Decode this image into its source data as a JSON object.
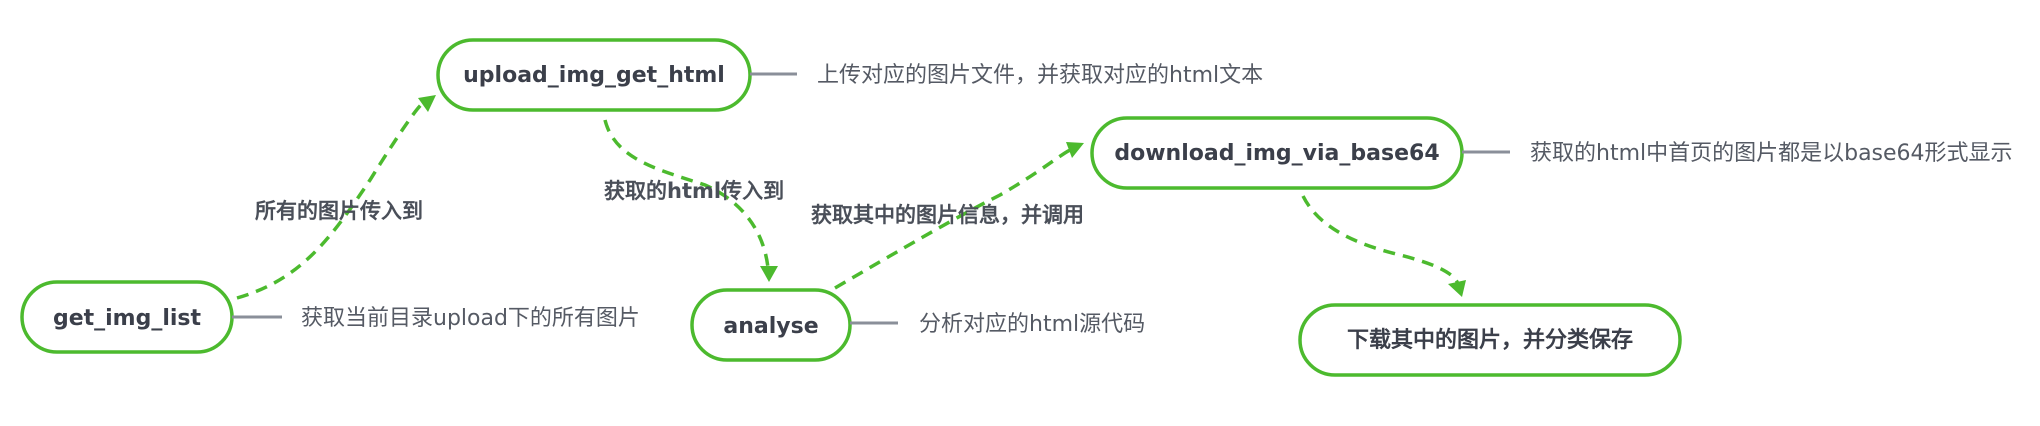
{
  "nodes": {
    "get_img_list": {
      "label": "get_img_list",
      "desc": "获取当前目录upload下的所有图片"
    },
    "upload_img_get_html": {
      "label": "upload_img_get_html",
      "desc": "上传对应的图片文件，并获取对应的html文本"
    },
    "analyse": {
      "label": "analyse",
      "desc": "分析对应的html源代码"
    },
    "download_img_via_base64": {
      "label": "download_img_via_base64",
      "desc": "获取的html中首页的图片都是以base64形式显示"
    },
    "save": {
      "label": "下载其中的图片，并分类保存"
    }
  },
  "edges": {
    "e1": {
      "from": "get_img_list",
      "to": "upload_img_get_html",
      "label": "所有的图片传入到"
    },
    "e2": {
      "from": "upload_img_get_html",
      "to": "analyse",
      "label": "获取的html传入到"
    },
    "e3": {
      "from": "analyse",
      "to": "download_img_via_base64",
      "label": "获取其中的图片信息，并调用"
    },
    "e4": {
      "from": "download_img_via_base64",
      "to": "save",
      "label": ""
    }
  },
  "colors": {
    "node_border": "#4cba2e",
    "edge": "#4cba2e",
    "node_text": "#3b3f4a",
    "desc_text": "#555a64",
    "desc_line": "#8a8f99"
  }
}
